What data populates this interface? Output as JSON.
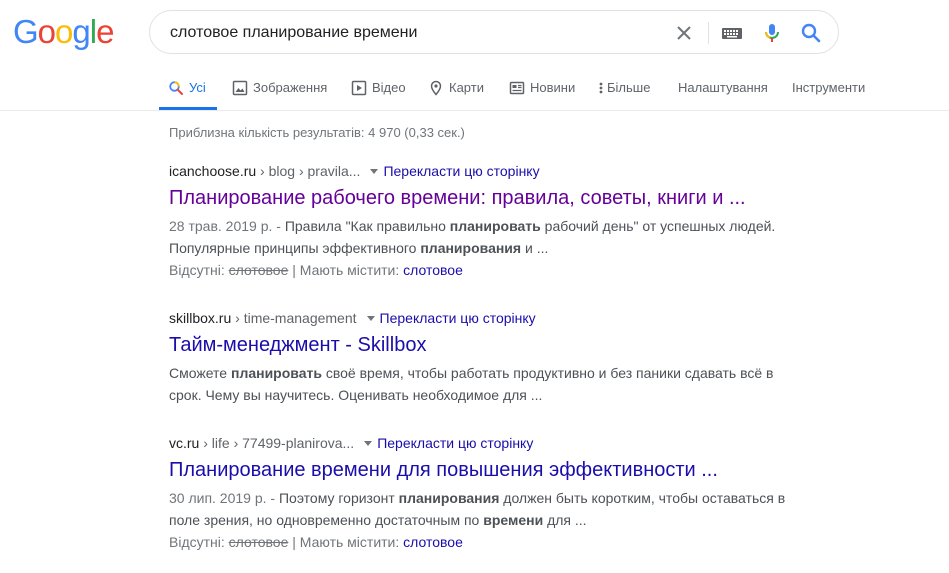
{
  "logo": {
    "letters": [
      "G",
      "o",
      "o",
      "g",
      "l",
      "e"
    ],
    "colors": [
      "#4285f4",
      "#ea4335",
      "#fbbc05",
      "#4285f4",
      "#34a853",
      "#ea4335"
    ]
  },
  "search": {
    "query": "слотовое планирование времени"
  },
  "icons": {
    "clear": "close-icon",
    "keyboard": "keyboard-icon",
    "voice": "microphone-icon",
    "search": "search-icon"
  },
  "tabs": [
    {
      "label": "Усі",
      "icon": "search-icon",
      "active": true
    },
    {
      "label": "Зображення",
      "icon": "image-icon"
    },
    {
      "label": "Відео",
      "icon": "video-icon"
    },
    {
      "label": "Карти",
      "icon": "map-pin-icon"
    },
    {
      "label": "Новини",
      "icon": "news-icon"
    },
    {
      "label": "Більше",
      "icon": "more-vert-icon"
    },
    {
      "label": "Налаштування"
    },
    {
      "label": "Інструменти"
    }
  ],
  "stats": "Приблизна кількість результатів: 4 970 (0,33 сек.)",
  "translate_label": "Перекласти цю сторінку",
  "results": [
    {
      "domain": "icanchoose.ru",
      "path": " › blog › pravila...",
      "title": "Планирование рабочего времени: правила, советы, книги и ...",
      "date": "28 трав. 2019 р. - ",
      "s1": "Правила \"Как правильно ",
      "b1": "планировать",
      "s2": " рабочий день\" от успешных людей. Популярные принципы эффективного ",
      "b2": "планирования",
      "s3": " и ...",
      "missing_label": "Відсутні: ",
      "missing_word": "слотовое",
      "must_label": " | Мають містити: ",
      "must_word": "слотовое"
    },
    {
      "domain": "skillbox.ru",
      "path": " › time-management",
      "title": "Тайм-менеджмент - Skillbox",
      "s1": "Сможете ",
      "b1": "планировать",
      "s2": " своё время, чтобы работать продуктивно и без паники сдавать всё в срок. Чему вы научитесь. Оценивать необходимое для ..."
    },
    {
      "domain": "vc.ru",
      "path": " › life › 77499-planirova...",
      "title": "Планирование времени для повышения эффективности ...",
      "date": "30 лип. 2019 р. - ",
      "s1": "Поэтому горизонт ",
      "b1": "планирования",
      "s2": " должен быть коротким, чтобы оставаться в поле зрения, но одновременно достаточным по ",
      "b2": "времени",
      "s3": " для ...",
      "missing_label": "Відсутні: ",
      "missing_word": "слотовое",
      "must_label": " | Мають містити: ",
      "must_word": "слотовое"
    }
  ]
}
